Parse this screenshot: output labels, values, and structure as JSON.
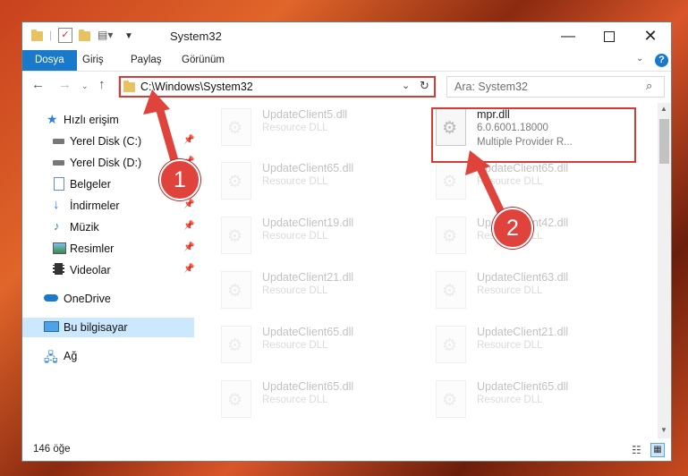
{
  "window": {
    "title": "System32"
  },
  "ribbon": {
    "tabs": [
      "Dosya",
      "Giriş",
      "Paylaş",
      "Görünüm"
    ],
    "help": "?"
  },
  "address": {
    "path": "C:\\Windows\\System32"
  },
  "search": {
    "placeholder": "Ara: System32"
  },
  "nav": [
    {
      "label": "Hızlı erişim",
      "icon": "star-icon",
      "pinned": false
    },
    {
      "label": "Yerel Disk (C:)",
      "icon": "drive-icon",
      "pinned": true
    },
    {
      "label": "Yerel Disk (D:)",
      "icon": "drive-icon",
      "pinned": true
    },
    {
      "label": "Belgeler",
      "icon": "document-icon",
      "pinned": true
    },
    {
      "label": "İndirmeler",
      "icon": "download-icon",
      "pinned": true
    },
    {
      "label": "Müzik",
      "icon": "music-icon",
      "pinned": true
    },
    {
      "label": "Resimler",
      "icon": "picture-icon",
      "pinned": true
    },
    {
      "label": "Videolar",
      "icon": "video-icon",
      "pinned": true
    },
    {
      "label": "OneDrive",
      "icon": "cloud-icon",
      "pinned": false
    },
    {
      "label": "Bu bilgisayar",
      "icon": "computer-icon",
      "pinned": false,
      "selected": true
    },
    {
      "label": "Ağ",
      "icon": "network-icon",
      "pinned": false
    }
  ],
  "files": [
    {
      "name": "UpdateClient5.dll",
      "lines": [
        "Resource DLL"
      ]
    },
    {
      "name": "mpr.dll",
      "lines": [
        "6.0.6001.18000",
        "Multiple Provider R..."
      ],
      "highlight": true
    },
    {
      "name": "UpdateClient65.dll",
      "lines": [
        "Resource DLL"
      ]
    },
    {
      "name": "UpdateClient65.dll",
      "lines": [
        "Resource DLL"
      ]
    },
    {
      "name": "UpdateClient19.dll",
      "lines": [
        "Resource DLL"
      ]
    },
    {
      "name": "UpdateClient42.dll",
      "lines": [
        "Resource DLL"
      ]
    },
    {
      "name": "UpdateClient21.dll",
      "lines": [
        "Resource DLL"
      ]
    },
    {
      "name": "UpdateClient63.dll",
      "lines": [
        "Resource DLL"
      ]
    },
    {
      "name": "UpdateClient65.dll",
      "lines": [
        "Resource DLL"
      ]
    },
    {
      "name": "UpdateClient21.dll",
      "lines": [
        "Resource DLL"
      ]
    },
    {
      "name": "UpdateClient65.dll",
      "lines": [
        "Resource DLL"
      ]
    },
    {
      "name": "UpdateClient65.dll",
      "lines": [
        "Resource DLL"
      ]
    }
  ],
  "status": {
    "count": "146 öğe"
  },
  "callouts": [
    "1",
    "2"
  ],
  "colors": {
    "accent": "#1979ca",
    "highlight_border": "#d63a35",
    "callout": "#e0433c"
  }
}
